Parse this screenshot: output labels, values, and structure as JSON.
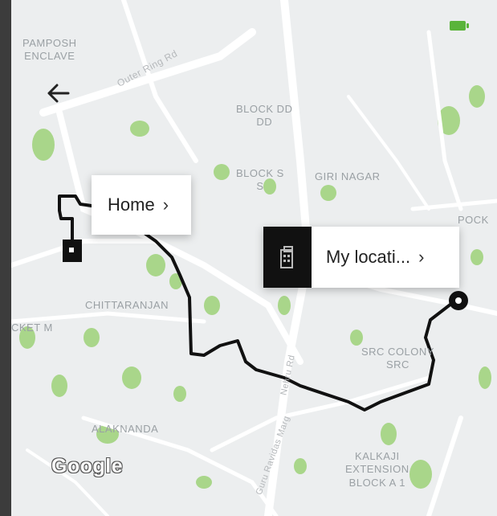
{
  "status_bar": {
    "battery_color": "#5ab43a"
  },
  "map": {
    "labels": [
      {
        "id": "pamposh",
        "text": "PAMPOSH\nENCLAVE"
      },
      {
        "id": "block_dd",
        "text": "BLOCK DD\nDD"
      },
      {
        "id": "block_s",
        "text": "BLOCK S\nS"
      },
      {
        "id": "giri_nagar",
        "text": "GIRI NAGAR"
      },
      {
        "id": "chittaranjan",
        "text": "CHITTARANJAN"
      },
      {
        "id": "pocket",
        "text": "POCK"
      },
      {
        "id": "pocket_m",
        "text": "CKET M"
      },
      {
        "id": "src_colony",
        "text": "SRC COLONY\nSRC"
      },
      {
        "id": "alaknanda",
        "text": "ALAKNANDA"
      },
      {
        "id": "kalkaji",
        "text": "KALKAJI\nEXTENSION\nBLOCK A 1"
      }
    ],
    "road_labels": [
      {
        "id": "outer_ring",
        "text": "Outer Ring Rd"
      },
      {
        "id": "vertical_road",
        "text": "Nehru Rd"
      },
      {
        "id": "bottom_road",
        "text": "Guru Ravidas Marg"
      }
    ],
    "route_color": "#111111",
    "park_color": "#a9d68a"
  },
  "callouts": {
    "home": {
      "label": "Home",
      "chevron": "›"
    },
    "my_location": {
      "label": "My locati... ",
      "chevron": "›"
    }
  },
  "brand": {
    "google": "Google"
  }
}
